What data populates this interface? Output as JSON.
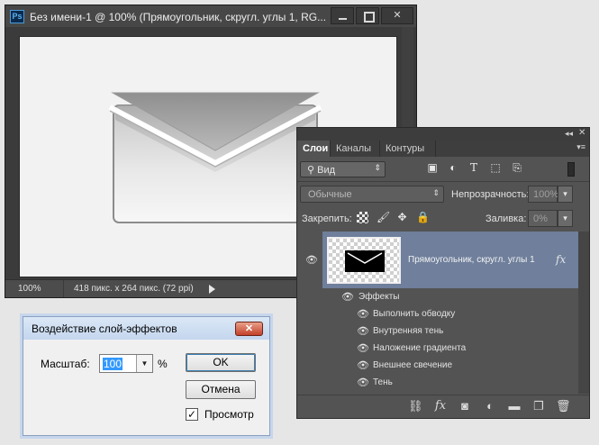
{
  "document": {
    "app_icon": "Ps",
    "title": "Без имени-1 @ 100% (Прямоугольник, скругл. углы 1, RG...",
    "minimize_icon": "minimize-icon",
    "maximize_icon": "maximize-icon",
    "close_icon": "close-icon",
    "close_glyph": "✕",
    "zoom": "100%",
    "size_info": "418 пикс. x 264 пикс. (72 ppi)"
  },
  "layers_panel": {
    "collapse_glyph": "◂◂",
    "close_glyph": "✕",
    "tabs": [
      {
        "label": "Слои",
        "active": true
      },
      {
        "label": "Каналы",
        "active": false
      },
      {
        "label": "Контуры",
        "active": false
      }
    ],
    "menu_glyph": "▾≡",
    "filter": {
      "label": "Вид",
      "icon": "search-icon"
    },
    "filter_icons": [
      "image-filter-icon",
      "adjustment-filter-icon",
      "type-filter-icon",
      "shape-filter-icon",
      "smart-object-filter-icon"
    ],
    "blend_mode": "Обычные",
    "opacity_label": "Непрозрачность:",
    "opacity_value": "100%",
    "lock_label": "Закрепить:",
    "lock_icons": [
      "lock-transparency-icon",
      "lock-pixels-icon",
      "lock-position-icon",
      "lock-all-icon"
    ],
    "fill_label": "Заливка:",
    "fill_value": "0%",
    "layer": {
      "name": "Прямоугольник, скругл. углы 1",
      "fx": "fx",
      "selected": true
    },
    "effects_label": "Эффекты",
    "effects": [
      "Выполнить обводку",
      "Внутренняя тень",
      "Наложение градиента",
      "Внешнее свечение",
      "Тень"
    ],
    "bottom_icons": [
      "link-layers-icon",
      "fx-icon",
      "mask-icon",
      "adjustment-layer-icon",
      "group-folder-icon",
      "new-layer-icon",
      "trash-icon"
    ],
    "bottom_fx": "fx",
    "accent_color": "#6f7f9c"
  },
  "dialog": {
    "title": "Воздействие слой-эффектов",
    "close_glyph": "✕",
    "scale_label": "Масштаб:",
    "scale_value": "100",
    "percent": "%",
    "ok_label": "OK",
    "cancel_label": "Отмена",
    "preview_label": "Просмотр",
    "preview_checked": true,
    "check_glyph": "✓"
  }
}
